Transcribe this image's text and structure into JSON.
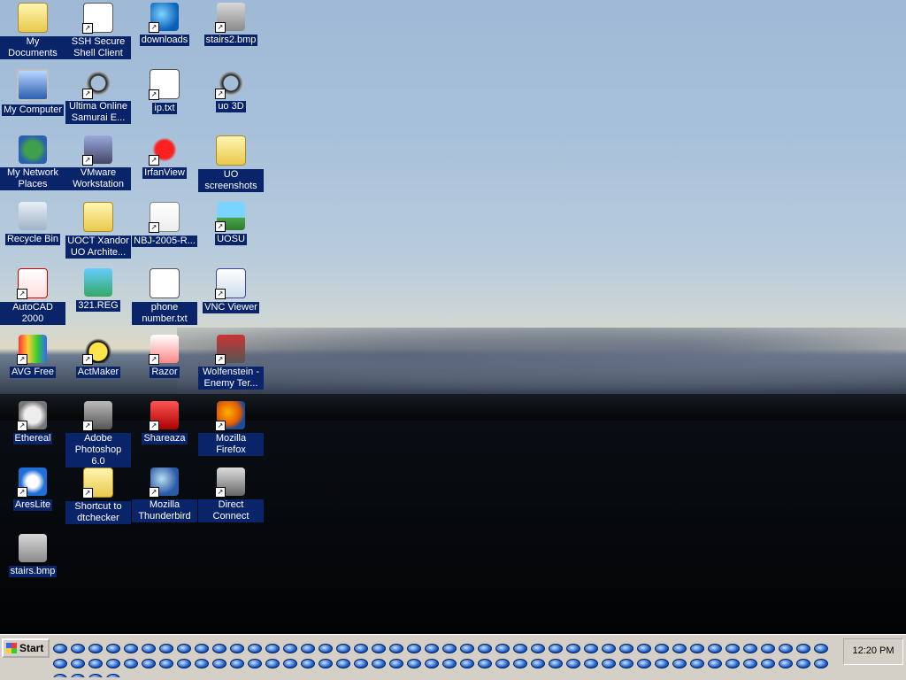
{
  "desktop": {
    "icons": [
      {
        "label": "My Documents",
        "glyph": "g-folder",
        "shortcut": false,
        "icon": "folder-icon"
      },
      {
        "label": "SSH Secure Shell Client",
        "glyph": "g-doc",
        "shortcut": true,
        "icon": "terminal-icon"
      },
      {
        "label": "downloads",
        "glyph": "g-globe",
        "shortcut": true,
        "icon": "globe-icon"
      },
      {
        "label": "stairs2.bmp",
        "glyph": "g-pencils",
        "shortcut": true,
        "icon": "paint-icon"
      },
      {
        "label": "My Computer",
        "glyph": "g-monitor",
        "shortcut": false,
        "icon": "computer-icon"
      },
      {
        "label": "Ultima Online Samurai E...",
        "glyph": "g-horseshoe",
        "shortcut": true,
        "icon": "game-icon"
      },
      {
        "label": "ip.txt",
        "glyph": "g-doc",
        "shortcut": true,
        "icon": "text-file-icon"
      },
      {
        "label": "uo 3D",
        "glyph": "g-horseshoe",
        "shortcut": true,
        "icon": "game-icon"
      },
      {
        "label": "My Network Places",
        "glyph": "g-net",
        "shortcut": false,
        "icon": "network-icon"
      },
      {
        "label": "VMware Workstation",
        "glyph": "g-vmware",
        "shortcut": true,
        "icon": "vmware-icon"
      },
      {
        "label": "IrfanView",
        "glyph": "g-red",
        "shortcut": true,
        "icon": "irfanview-icon"
      },
      {
        "label": "UO screenshots",
        "glyph": "g-folder",
        "shortcut": false,
        "icon": "folder-icon"
      },
      {
        "label": "Recycle Bin",
        "glyph": "g-bin",
        "shortcut": false,
        "icon": "recycle-bin-icon"
      },
      {
        "label": "UOCT Xandor UO Archite...",
        "glyph": "g-folder",
        "shortcut": false,
        "icon": "folder-icon"
      },
      {
        "label": "NBJ-2005-R...",
        "glyph": "g-pdf",
        "shortcut": true,
        "icon": "pdf-icon"
      },
      {
        "label": "UOSU",
        "glyph": "g-uosu",
        "shortcut": true,
        "icon": "landscape-icon"
      },
      {
        "label": "AutoCAD 2000",
        "glyph": "g-acad",
        "shortcut": true,
        "icon": "autocad-icon"
      },
      {
        "label": "321.REG",
        "glyph": "g-reg",
        "shortcut": false,
        "icon": "registry-icon"
      },
      {
        "label": "phone number.txt",
        "glyph": "g-doc",
        "shortcut": false,
        "icon": "text-file-icon"
      },
      {
        "label": "VNC Viewer",
        "glyph": "g-vnc",
        "shortcut": true,
        "icon": "vnc-icon"
      },
      {
        "label": "AVG Free",
        "glyph": "g-avg",
        "shortcut": true,
        "icon": "antivirus-icon"
      },
      {
        "label": "ActMaker",
        "glyph": "g-helmet",
        "shortcut": true,
        "icon": "helmet-icon"
      },
      {
        "label": "Razor",
        "glyph": "g-razor",
        "shortcut": true,
        "icon": "razor-icon"
      },
      {
        "label": "Wolfenstein - Enemy Ter...",
        "glyph": "g-wolf",
        "shortcut": true,
        "icon": "wolfenstein-icon"
      },
      {
        "label": "Ethereal",
        "glyph": "g-eth",
        "shortcut": true,
        "icon": "ethereal-icon"
      },
      {
        "label": "Adobe Photoshop 6.0",
        "glyph": "g-ps",
        "shortcut": true,
        "icon": "photoshop-icon"
      },
      {
        "label": "Shareaza",
        "glyph": "g-shareaza",
        "shortcut": true,
        "icon": "shareaza-icon"
      },
      {
        "label": "Mozilla Firefox",
        "glyph": "g-firefox",
        "shortcut": true,
        "icon": "firefox-icon"
      },
      {
        "label": "AresLite",
        "glyph": "g-ares",
        "shortcut": true,
        "icon": "ares-icon"
      },
      {
        "label": "Shortcut to dtchecker",
        "glyph": "g-folder",
        "shortcut": true,
        "icon": "folder-icon"
      },
      {
        "label": "Mozilla Thunderbird",
        "glyph": "g-tbird",
        "shortcut": true,
        "icon": "thunderbird-icon"
      },
      {
        "label": "Direct Connect",
        "glyph": "g-dc",
        "shortcut": true,
        "icon": "direct-connect-icon"
      },
      {
        "label": "stairs.bmp",
        "glyph": "g-pencils",
        "shortcut": false,
        "icon": "paint-icon"
      }
    ]
  },
  "taskbar": {
    "start_label": "Start",
    "task_icon": "internet-explorer-icon",
    "task_count": 92,
    "clock": "12:20 PM"
  }
}
